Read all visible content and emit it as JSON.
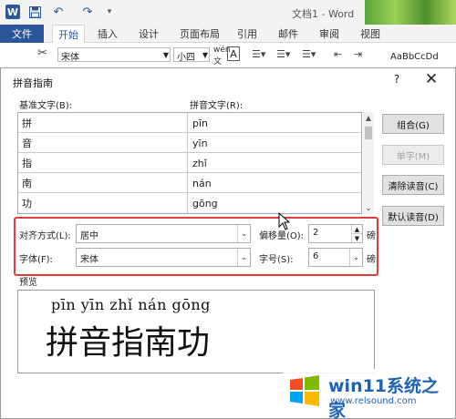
{
  "app": {
    "doc_title": "文档1 - Word",
    "word_logo": "W"
  },
  "ribbon": {
    "file_tab": "文件",
    "tabs": [
      "开始",
      "插入",
      "设计",
      "页面布局",
      "引用",
      "邮件",
      "审阅",
      "视图"
    ],
    "font_name": "宋体",
    "font_size": "小四",
    "wen_label": "wén\n文",
    "char_border": "A",
    "style_preview": "AaBbCcDd"
  },
  "dialog": {
    "title": "拼音指南",
    "help": "?",
    "close": "✕",
    "base_text_label": "基准文字(B):",
    "ruby_text_label": "拼音文字(R):",
    "rows": [
      {
        "base": "拼",
        "ruby": "pīn"
      },
      {
        "base": "音",
        "ruby": "yīn"
      },
      {
        "base": "指",
        "ruby": "zhǐ"
      },
      {
        "base": "南",
        "ruby": "nán"
      },
      {
        "base": "功",
        "ruby": "gōng"
      }
    ],
    "buttons": {
      "combine": "组合(G)",
      "single": "单字(M)",
      "clear": "清除读音(C)",
      "default": "默认读音(D)"
    },
    "alignment_label": "对齐方式(L):",
    "alignment_value": "居中",
    "offset_label": "偏移量(O):",
    "offset_value": "2",
    "offset_unit": "磅",
    "font_label": "字体(F):",
    "font_value": "宋体",
    "size_label": "字号(S):",
    "size_value": "6",
    "size_unit": "磅",
    "preview_label": "预览",
    "preview_ruby": "pīn yīn zhǐ nán gōng",
    "preview_base": "拼音指南功"
  },
  "watermark": {
    "name": "win11系统之家",
    "url": "www.relsound.com"
  },
  "colors": {
    "word_blue": "#2b579a",
    "highlight_red": "#e43c3c",
    "watermark_blue": "#1b63b5"
  }
}
